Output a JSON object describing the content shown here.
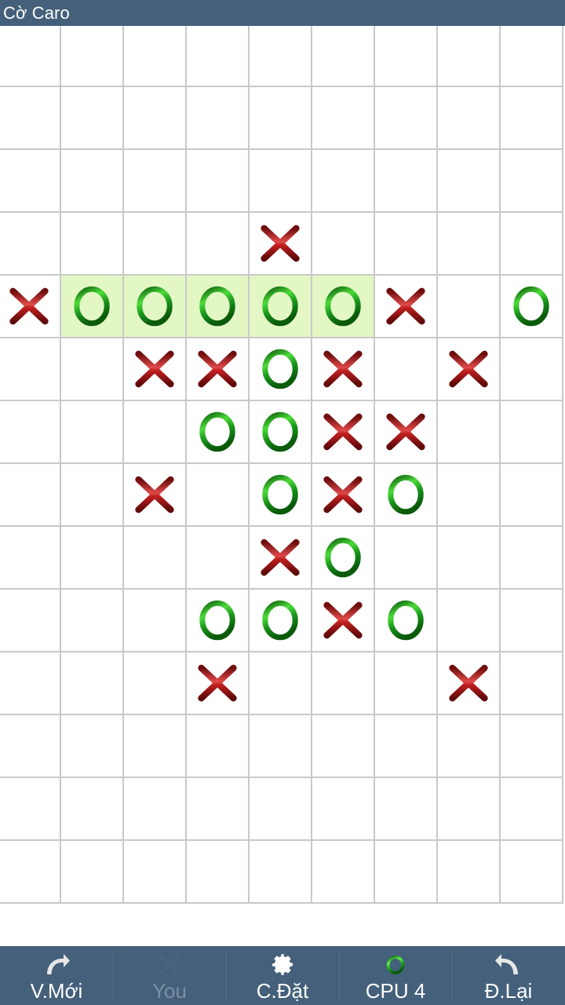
{
  "app": {
    "title": "Cờ Caro",
    "titlebar_color": "#44607a",
    "board_bg": "#ffffff",
    "grid_line_color": "#c9c9c9",
    "x_color": "#8b1414",
    "o_color": "#1a8a1a",
    "win_highlight_color": "#e3f7c4"
  },
  "board": {
    "columns": 9,
    "rows": 14,
    "cell_size": 80,
    "legend": {
      "empty": "",
      "x": "X",
      "o": "O"
    },
    "cells": [
      [
        "",
        "",
        "",
        "",
        "",
        "",
        "",
        "",
        ""
      ],
      [
        "",
        "",
        "",
        "",
        "",
        "",
        "",
        "",
        ""
      ],
      [
        "",
        "",
        "",
        "",
        "",
        "",
        "",
        "",
        ""
      ],
      [
        "",
        "",
        "",
        "",
        "X",
        "",
        "",
        "",
        ""
      ],
      [
        "X",
        "O",
        "O",
        "O",
        "O",
        "O",
        "X",
        "",
        "O"
      ],
      [
        "",
        "",
        "X",
        "X",
        "O",
        "X",
        "",
        "X",
        ""
      ],
      [
        "",
        "",
        "",
        "O",
        "O",
        "X",
        "X",
        "",
        ""
      ],
      [
        "",
        "",
        "X",
        "",
        "O",
        "X",
        "O",
        "",
        ""
      ],
      [
        "",
        "",
        "",
        "",
        "X",
        "O",
        "",
        "",
        ""
      ],
      [
        "",
        "",
        "",
        "O",
        "O",
        "X",
        "O",
        "",
        ""
      ],
      [
        "",
        "",
        "",
        "X",
        "",
        "",
        "",
        "X",
        ""
      ],
      [
        "",
        "",
        "",
        "",
        "",
        "",
        "",
        "",
        ""
      ],
      [
        "",
        "",
        "",
        "",
        "",
        "",
        "",
        "",
        ""
      ],
      [
        "",
        "",
        "",
        "",
        "",
        "",
        "",
        "",
        ""
      ]
    ],
    "winning_line": {
      "row": 4,
      "columns": [
        1,
        2,
        3,
        4,
        5
      ],
      "player": "O"
    }
  },
  "toolbar": {
    "items": [
      {
        "label": "V.Mới",
        "icon": "redo-arrow-icon",
        "name": "new-game-button",
        "disabled": false
      },
      {
        "label": "You",
        "icon": "x-mark-icon",
        "name": "player-you-button",
        "disabled": true
      },
      {
        "label": "C.Đặt",
        "icon": "gear-icon",
        "name": "settings-button",
        "disabled": false
      },
      {
        "label": "CPU 4",
        "icon": "o-mark-icon",
        "name": "cpu-level-button",
        "disabled": false
      },
      {
        "label": "Đ.Lại",
        "icon": "undo-arrow-icon",
        "name": "undo-button",
        "disabled": false
      }
    ]
  }
}
